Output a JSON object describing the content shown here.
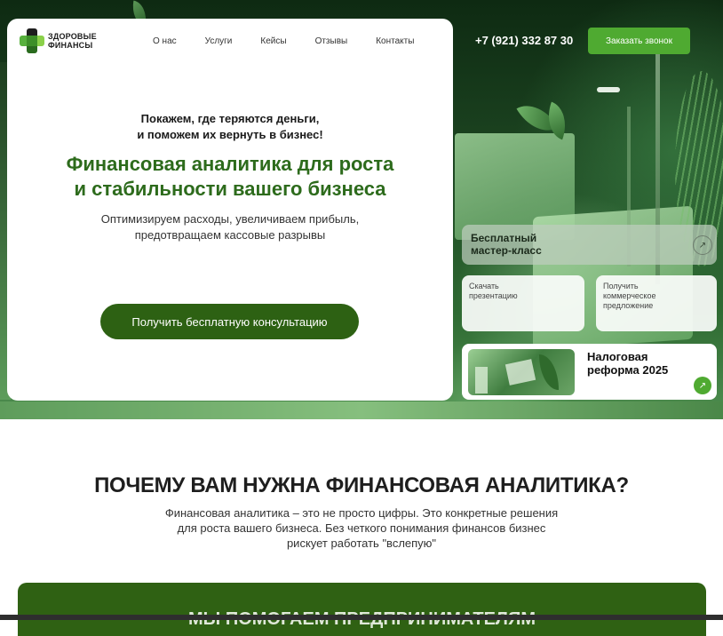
{
  "brand": {
    "logo_line1": "ЗДОРОВЫЕ",
    "logo_line2": "ФИНАНСЫ"
  },
  "nav": {
    "items": [
      "О нас",
      "Услуги",
      "Кейсы",
      "Отзывы",
      "Контакты"
    ]
  },
  "header": {
    "phone": "+7 (921) 332 87 30",
    "callback_label": "Заказать звонок"
  },
  "hero": {
    "subtitle_line1": "Покажем, где теряются деньги,",
    "subtitle_line2": "и поможем их вернуть в бизнес!",
    "title_line1": "Финансовая аналитика для роста",
    "title_line2": "и стабильности вашего бизнеса",
    "desc_line1": "Оптимизируем расходы, увеличиваем прибыль,",
    "desc_line2": "предотвращаем кассовые разрывы",
    "cta_label": "Получить бесплатную консультацию"
  },
  "tiles": {
    "masterclass_line1": "Бесплатный",
    "masterclass_line2": "мастер-класс",
    "presentation_line1": "Скачать",
    "presentation_line2": "презентацию",
    "offer_line1": "Получить",
    "offer_line2": "коммерческое",
    "offer_line3": "предложение",
    "tax_line1": "Налоговая",
    "tax_line2": "реформа 2025",
    "arrow": "↗"
  },
  "why": {
    "title": "ПОЧЕМУ ВАМ НУЖНА ФИНАНСОВАЯ АНАЛИТИКА?",
    "desc_line1": "Финансовая аналитика – это не просто цифры. Это конкретные решения",
    "desc_line2": "для роста вашего бизнеса. Без четкого понимания финансов бизнес",
    "desc_line3": "рискует работать \"вслепую\"",
    "band_title": "МЫ ПОМОГАЕМ ПРЕДПРИНИМАТЕЛЯМ"
  },
  "colors": {
    "accent": "#4faa31",
    "brand_dark": "#2d6113",
    "title_green": "#2d6b1c"
  }
}
